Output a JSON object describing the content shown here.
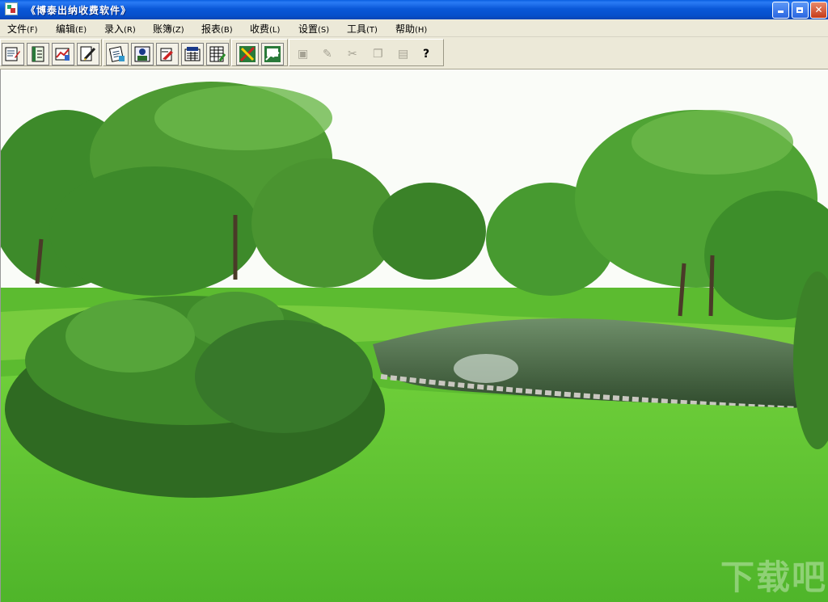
{
  "window": {
    "title": "《博泰出纳收费软件》",
    "icon": "app-icon",
    "controls": [
      "minimize-icon",
      "restore-icon",
      "close-icon"
    ]
  },
  "menu": [
    {
      "label": "文件",
      "key": "(F)"
    },
    {
      "label": "编辑",
      "key": "(E)"
    },
    {
      "label": "录入",
      "key": "(R)"
    },
    {
      "label": "账簿",
      "key": "(Z)"
    },
    {
      "label": "报表",
      "key": "(B)"
    },
    {
      "label": "收费",
      "key": "(L)"
    },
    {
      "label": "设置",
      "key": "(S)"
    },
    {
      "label": "工具",
      "key": "(T)"
    },
    {
      "label": "帮助",
      "key": "(H)"
    }
  ],
  "toolbar": {
    "group1_icons": [
      "voucher-entry-icon",
      "ledger-icon",
      "report-icon",
      "edit-icon"
    ],
    "group2_icons": [
      "document-icon",
      "user-icon",
      "print-icon",
      "calculator-icon",
      "table-icon"
    ],
    "group3_icons": [
      "tools-icon",
      "settings-icon"
    ],
    "group4_icons": [
      "save-icon",
      "pencil-icon",
      "cut-icon",
      "copy-icon",
      "paste-icon",
      "help-icon"
    ],
    "help_glyph": "?"
  },
  "background": {
    "description_colors": {
      "sky": "#fafcf8",
      "grass": "#5dc22f",
      "foliage": "#3f8c2a",
      "water": "#3c5e3a"
    }
  },
  "watermark": {
    "text": "下载吧"
  }
}
